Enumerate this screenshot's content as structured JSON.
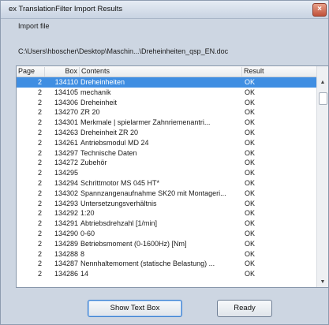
{
  "window": {
    "title": "ex TranslationFilter Import Results",
    "close_glyph": "×"
  },
  "import_file": {
    "label": "Import file",
    "path": "C:\\Users\\hboscher\\Desktop\\Maschin...\\Dreheinheiten_qsp_EN.doc"
  },
  "table": {
    "columns": {
      "page": "Page",
      "box": "Box",
      "contents": "Contents",
      "result": "Result"
    },
    "selected_index": 0,
    "rows": [
      {
        "page": "2",
        "box": "134110",
        "contents": "Dreheinheiten",
        "result": "OK"
      },
      {
        "page": "2",
        "box": "134105",
        "contents": "mechanik",
        "result": "OK"
      },
      {
        "page": "2",
        "box": "134306",
        "contents": "Dreheinheit",
        "result": "OK"
      },
      {
        "page": "2",
        "box": "134270",
        "contents": "ZR 20",
        "result": "OK"
      },
      {
        "page": "2",
        "box": "134301",
        "contents": "Merkmale  |  spielarmer Zahnriemenantri...",
        "result": "OK"
      },
      {
        "page": "2",
        "box": "134263",
        "contents": "Dreheinheit ZR 20",
        "result": "OK"
      },
      {
        "page": "2",
        "box": "134261",
        "contents": "Antriebsmodul MD 24",
        "result": "OK"
      },
      {
        "page": "2",
        "box": "134297",
        "contents": "Technische Daten",
        "result": "OK"
      },
      {
        "page": "2",
        "box": "134272",
        "contents": "Zubehör",
        "result": "OK"
      },
      {
        "page": "2",
        "box": "134295",
        "contents": "",
        "result": "OK"
      },
      {
        "page": "2",
        "box": "134294",
        "contents": "Schrittmotor  MS 045 HT*",
        "result": "OK"
      },
      {
        "page": "2",
        "box": "134302",
        "contents": "Spannzangenaufnahme SK20 mit Montageri...",
        "result": "OK"
      },
      {
        "page": "2",
        "box": "134293",
        "contents": "Untersetzungsverhältnis",
        "result": "OK"
      },
      {
        "page": "2",
        "box": "134292",
        "contents": "1:20",
        "result": "OK"
      },
      {
        "page": "2",
        "box": "134291",
        "contents": "Abtriebsdrehzahl  [1/min]",
        "result": "OK"
      },
      {
        "page": "2",
        "box": "134290",
        "contents": "0-60",
        "result": "OK"
      },
      {
        "page": "2",
        "box": "134289",
        "contents": "Betriebsmoment (0-1600Hz)  [Nm]",
        "result": "OK"
      },
      {
        "page": "2",
        "box": "134288",
        "contents": "8",
        "result": "OK"
      },
      {
        "page": "2",
        "box": "134287",
        "contents": "Nennhaltemoment (statische Belastung) ...",
        "result": "OK"
      },
      {
        "page": "2",
        "box": "134286",
        "contents": "14",
        "result": "OK"
      }
    ]
  },
  "scrollbar": {
    "up_icon": "▲",
    "down_icon": "▼"
  },
  "buttons": {
    "show_text_box": "Show Text Box",
    "ready": "Ready"
  },
  "colors": {
    "selection": "#3f8ee2",
    "window_bg": "#cdd6e2"
  }
}
